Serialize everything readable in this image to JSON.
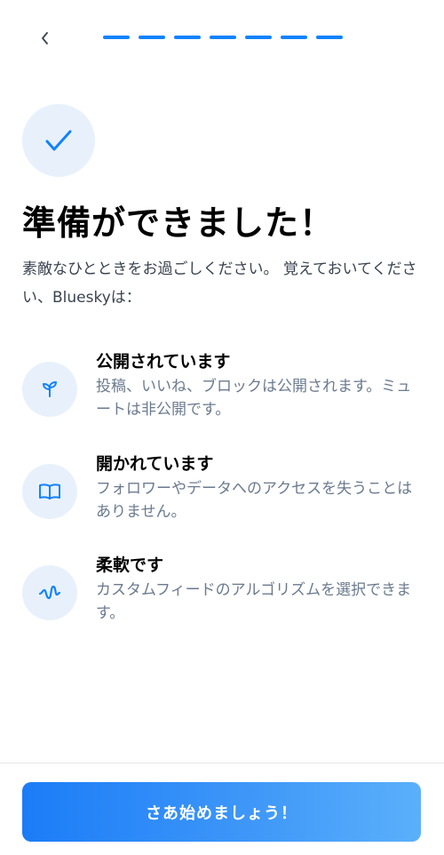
{
  "header": {
    "back_icon": "chevron-left-icon",
    "progress_steps": 7,
    "progress_completed": 7,
    "accent_color": "#1083fe"
  },
  "hero": {
    "icon": "check-icon",
    "title": "準備ができました！",
    "subtitle": "素敵なひとときをお過ごしください。 覚えておいてください、Blueskyは："
  },
  "features": [
    {
      "icon": "sprout-icon",
      "title": "公開されています",
      "description": "投稿、いいね、ブロックは公開されます。ミュートは非公開です。"
    },
    {
      "icon": "book-open-icon",
      "title": "開かれています",
      "description": "フォロワーやデータへのアクセスを失うことはありません。"
    },
    {
      "icon": "wave-icon",
      "title": "柔軟です",
      "description": "カスタムフィードのアルゴリズムを選択できます。"
    }
  ],
  "footer": {
    "start_label": "さあ始めましょう！"
  }
}
